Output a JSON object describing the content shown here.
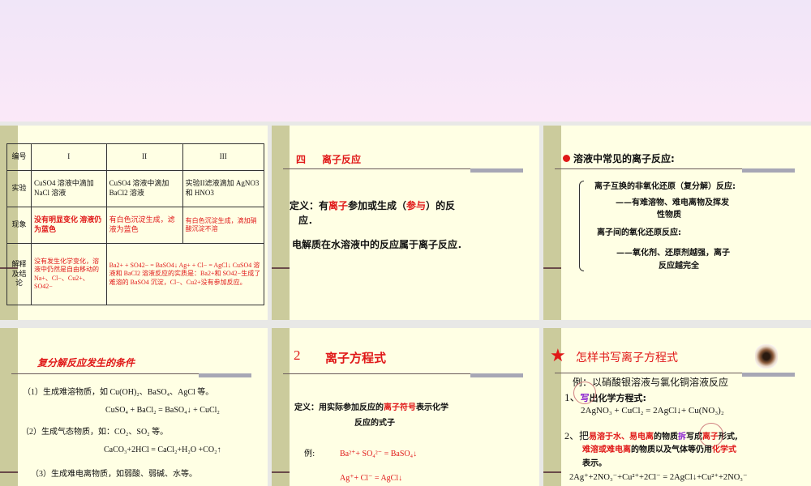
{
  "slides": [
    {
      "table": {
        "headers": [
          "编号",
          "I",
          "II",
          "III"
        ],
        "rows": [
          {
            "label": "实验",
            "cells": [
              "CuSO4 溶液中滴加 NaCl 溶液",
              "CuSO4 溶液中滴加 BaCl2 溶液",
              "实验II滤液滴加 AgNO3 和 HNO3"
            ]
          },
          {
            "label": "现象",
            "cells": [
              "没有明显变化 溶液仍为蓝色",
              "有白色沉淀生成，滤液为蓝色",
              "有白色沉淀生成，滴加硝酸沉淀不溶"
            ]
          },
          {
            "label": "解释及结论",
            "cells": [
              "没有发生化学变化，溶液中仍然是自由移动的 Na+、Cl−、Cu2+、SO42−",
              "Ba2+ + SO42− = BaSO4↓ Ag+ + Cl− = AgCl↓ CuSO4 溶液和 BaCl2 溶液反应的实质是：Ba2+和 SO42−生成了难溶的 BaSO4 沉淀，Cl−、Cu2+没有参加反应。"
            ]
          }
        ]
      }
    },
    {
      "title_num": "四",
      "title": "离子反应",
      "def_a": "定义：有",
      "def_red1": "离子",
      "def_b": "参加或生成（",
      "def_red2": "参与",
      "def_c": "）的反",
      "def_d": "应．",
      "line2": "电解质在水溶液中的反应属于离子反应．"
    },
    {
      "title": "溶液中常见的离子反应:",
      "item1": "离子互换的非氧化还原（复分解）反应:",
      "item1a": "——有难溶物、难电离物及挥发",
      "item1b": "性物质",
      "item2": "离子间的氧化还原反应:",
      "item2a": "——氧化剂、还原剂越强，离子",
      "item2b": "反应越完全"
    },
    {
      "title": "复分解反应发生的条件",
      "c1": "（1）生成难溶物质，如 Cu(OH)₂、BaSO₄、AgCl 等。",
      "eq1": "CuSO₄ + BaCl₂ = BaSO₄↓ + CuCl₂",
      "c2": "（2）生成气态物质，如：CO₂、SO₂ 等。",
      "eq2": "CaCO₃+2HCl = CaCl₂+H₂O +CO₂↑",
      "c3": "（3）生成难电离物质，如弱酸、弱碱、水等。"
    },
    {
      "title_num": "2",
      "title": "离子方程式",
      "def_a": "定义：用实际参加反应的",
      "def_red": "离子符号",
      "def_b": "表示化学",
      "def_c": "反应的式子",
      "ex_label": "例:",
      "ex1": "Ba²⁺+ SO₄²⁻ = BaSO₄↓",
      "ex2": "Ag⁺+ Cl⁻ =  AgCl↓"
    },
    {
      "title": "怎样书写离子方程式",
      "example": "例：以硝酸银溶液与氯化铜溶液反应",
      "s1_num": "1、",
      "s1_key": "写",
      "s1_rest": "出化学方程式:",
      "eq1": "2AgNO₃ + CuCl₂ =  2AgCl↓+ Cu(NO₃)₂",
      "s2_num": "2、把",
      "s2_r1": "易溶于水、易电离",
      "s2_b": "的物质",
      "s2_key": "拆",
      "s2_c": "写成",
      "s2_r2": "离子",
      "s2_d": "形式,",
      "s2_r3": "难溶或难电离",
      "s2_e": "的物质以及气体等仍用",
      "s2_r4": "化学式",
      "s2_f": "表示。",
      "eq2": "2Ag⁺+2NO₃⁻+Cu²⁺+2Cl⁻ =  2AgCl↓+Cu²⁺+2NO₃⁻"
    }
  ]
}
